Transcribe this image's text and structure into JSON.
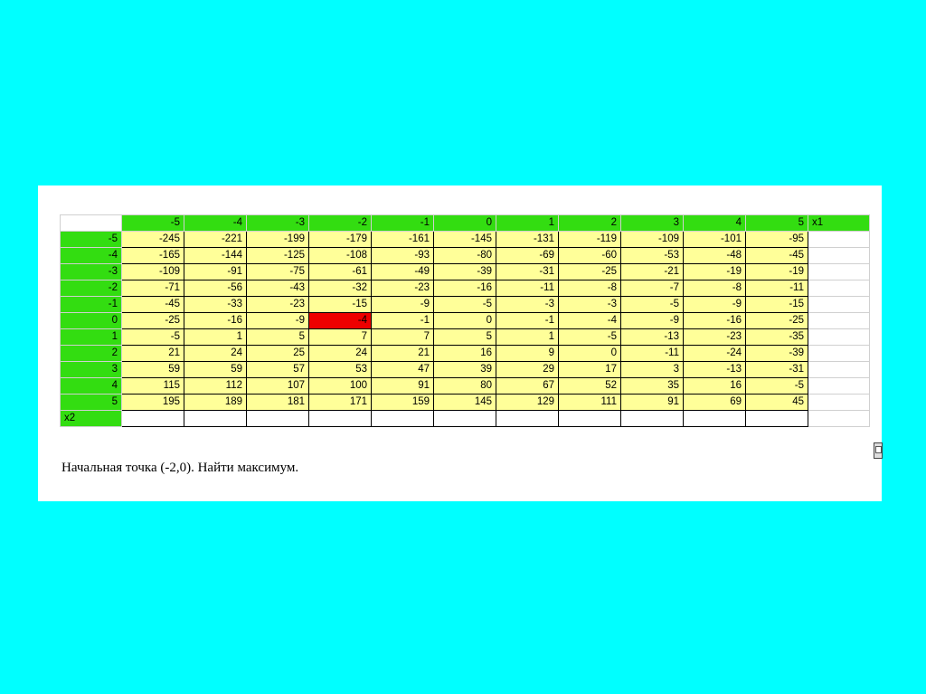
{
  "table": {
    "x1_values": [
      "-5",
      "-4",
      "-3",
      "-2",
      "-1",
      "0",
      "1",
      "2",
      "3",
      "4",
      "5"
    ],
    "x1_label": "x1",
    "x2_label": "x2",
    "highlight_color": "#ee0000",
    "rows": [
      {
        "x2": "-5",
        "values": [
          "-245",
          "-221",
          "-199",
          "-179",
          "-161",
          "-145",
          "-131",
          "-119",
          "-109",
          "-101",
          "-95"
        ]
      },
      {
        "x2": "-4",
        "values": [
          "-165",
          "-144",
          "-125",
          "-108",
          "-93",
          "-80",
          "-69",
          "-60",
          "-53",
          "-48",
          "-45"
        ]
      },
      {
        "x2": "-3",
        "values": [
          "-109",
          "-91",
          "-75",
          "-61",
          "-49",
          "-39",
          "-31",
          "-25",
          "-21",
          "-19",
          "-19"
        ]
      },
      {
        "x2": "-2",
        "values": [
          "-71",
          "-56",
          "-43",
          "-32",
          "-23",
          "-16",
          "-11",
          "-8",
          "-7",
          "-8",
          "-11"
        ]
      },
      {
        "x2": "-1",
        "values": [
          "-45",
          "-33",
          "-23",
          "-15",
          "-9",
          "-5",
          "-3",
          "-3",
          "-5",
          "-9",
          "-15"
        ]
      },
      {
        "x2": "0",
        "values": [
          "-25",
          "-16",
          "-9",
          "-4",
          "-1",
          "0",
          "-1",
          "-4",
          "-9",
          "-16",
          "-25"
        ]
      },
      {
        "x2": "1",
        "values": [
          "-5",
          "1",
          "5",
          "7",
          "7",
          "5",
          "1",
          "-5",
          "-13",
          "-23",
          "-35"
        ]
      },
      {
        "x2": "2",
        "values": [
          "21",
          "24",
          "25",
          "24",
          "21",
          "16",
          "9",
          "0",
          "-11",
          "-24",
          "-39"
        ]
      },
      {
        "x2": "3",
        "values": [
          "59",
          "59",
          "57",
          "53",
          "47",
          "39",
          "29",
          "17",
          "3",
          "-13",
          "-31"
        ]
      },
      {
        "x2": "4",
        "values": [
          "115",
          "112",
          "107",
          "100",
          "91",
          "80",
          "67",
          "52",
          "35",
          "16",
          "-5"
        ]
      },
      {
        "x2": "5",
        "values": [
          "195",
          "189",
          "181",
          "171",
          "159",
          "145",
          "129",
          "111",
          "91",
          "69",
          "45"
        ]
      }
    ],
    "highlight": {
      "row": 5,
      "col": 3
    }
  },
  "caption": "Начальная точка (-2,0). Найти максимум.",
  "icons": {
    "clip": "clipboard-icon"
  }
}
